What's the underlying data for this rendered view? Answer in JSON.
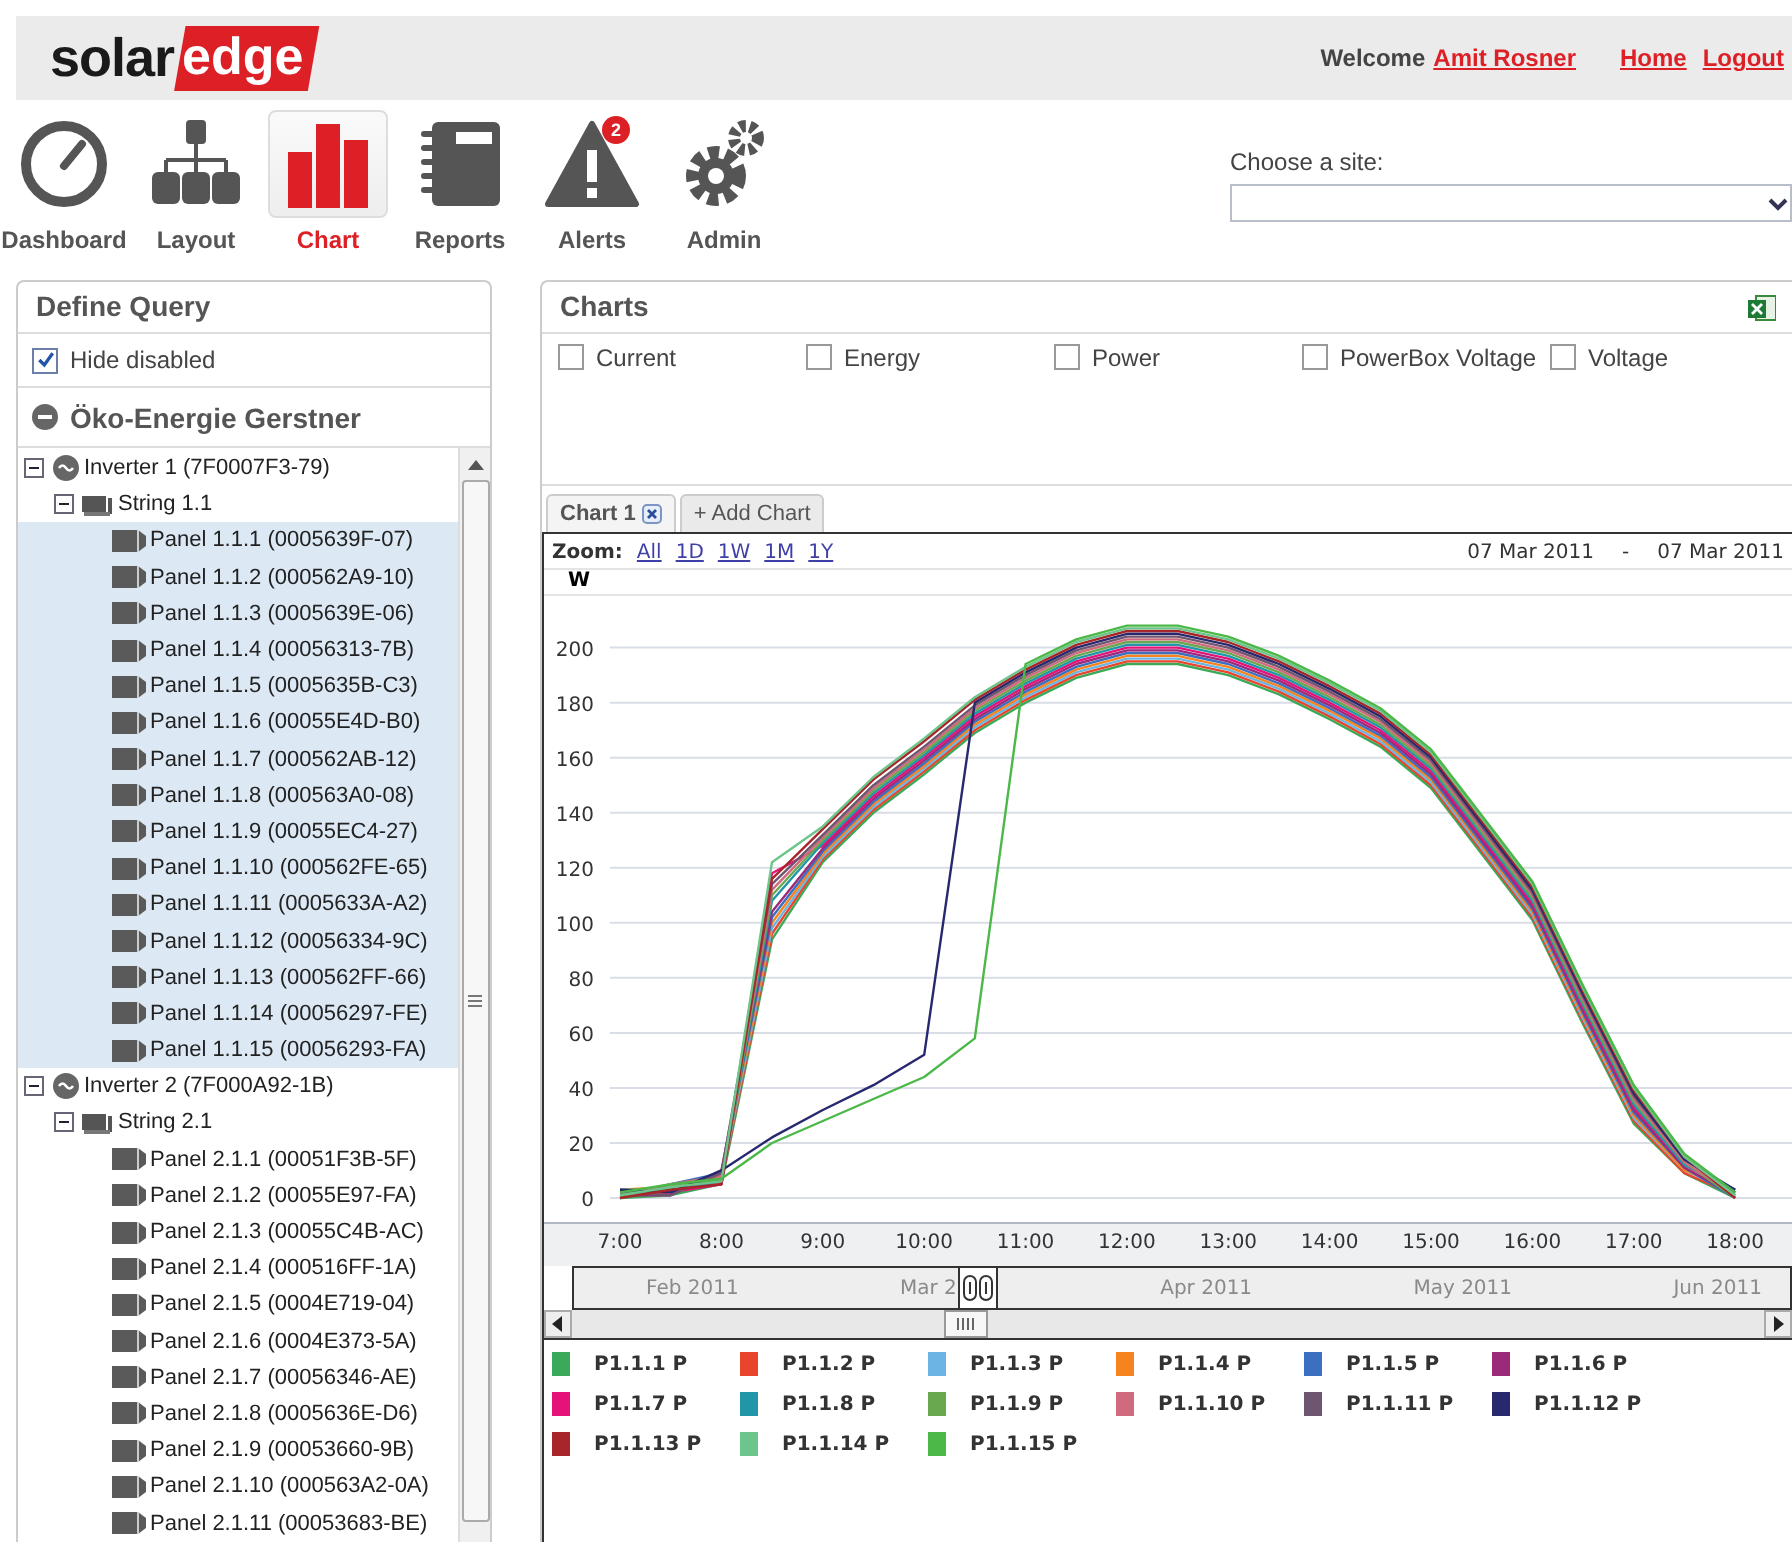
{
  "header": {
    "logo": {
      "text_1": "solar",
      "text_2": "edge"
    },
    "welcome": "Welcome",
    "user_link": "Amit Rosner",
    "links": [
      "Home",
      "Logout"
    ]
  },
  "nav": [
    {
      "label": "Dashboard",
      "kind": "gauge",
      "selected": false
    },
    {
      "label": "Layout",
      "kind": "hierarchy",
      "selected": false
    },
    {
      "label": "Chart",
      "kind": "bars",
      "selected": true
    },
    {
      "label": "Reports",
      "kind": "notebook",
      "selected": false
    },
    {
      "label": "Alerts",
      "kind": "warning",
      "selected": false,
      "badge": "2"
    },
    {
      "label": "Admin",
      "kind": "gears",
      "selected": false
    }
  ],
  "site_chooser": {
    "label": "Choose a site:"
  },
  "query_panel": {
    "title": "Define Query",
    "hide_disabled": {
      "label": "Hide disabled",
      "checked": true
    },
    "site_name": "Öko-Energie Gerstner",
    "tree": [
      {
        "label": "Inverter 1 (7F0007F3-79)",
        "kind": "inverter",
        "expanded": true,
        "selected": false,
        "children": [
          {
            "label": "String 1.1",
            "kind": "string",
            "expanded": true,
            "selected": false,
            "children": [
              {
                "label": "Panel 1.1.1 (0005639F-07)",
                "kind": "panel",
                "selected": true
              },
              {
                "label": "Panel 1.1.2 (000562A9-10)",
                "kind": "panel",
                "selected": true
              },
              {
                "label": "Panel 1.1.3 (0005639E-06)",
                "kind": "panel",
                "selected": true
              },
              {
                "label": "Panel 1.1.4 (00056313-7B)",
                "kind": "panel",
                "selected": true
              },
              {
                "label": "Panel 1.1.5 (0005635B-C3)",
                "kind": "panel",
                "selected": true
              },
              {
                "label": "Panel 1.1.6 (00055E4D-B0)",
                "kind": "panel",
                "selected": true
              },
              {
                "label": "Panel 1.1.7 (000562AB-12)",
                "kind": "panel",
                "selected": true
              },
              {
                "label": "Panel 1.1.8 (000563A0-08)",
                "kind": "panel",
                "selected": true
              },
              {
                "label": "Panel 1.1.9 (00055EC4-27)",
                "kind": "panel",
                "selected": true
              },
              {
                "label": "Panel 1.1.10 (000562FE-65)",
                "kind": "panel",
                "selected": true
              },
              {
                "label": "Panel 1.1.11 (0005633A-A2)",
                "kind": "panel",
                "selected": true
              },
              {
                "label": "Panel 1.1.12 (00056334-9C)",
                "kind": "panel",
                "selected": true
              },
              {
                "label": "Panel 1.1.13 (000562FF-66)",
                "kind": "panel",
                "selected": true
              },
              {
                "label": "Panel 1.1.14 (00056297-FE)",
                "kind": "panel",
                "selected": true
              },
              {
                "label": "Panel 1.1.15 (00056293-FA)",
                "kind": "panel",
                "selected": true
              }
            ]
          }
        ]
      },
      {
        "label": "Inverter 2 (7F000A92-1B)",
        "kind": "inverter",
        "expanded": true,
        "selected": false,
        "children": [
          {
            "label": "String 2.1",
            "kind": "string",
            "expanded": true,
            "selected": false,
            "children": [
              {
                "label": "Panel 2.1.1 (00051F3B-5F)",
                "kind": "panel",
                "selected": false
              },
              {
                "label": "Panel 2.1.2 (00055E97-FA)",
                "kind": "panel",
                "selected": false
              },
              {
                "label": "Panel 2.1.3 (00055C4B-AC)",
                "kind": "panel",
                "selected": false
              },
              {
                "label": "Panel 2.1.4 (000516FF-1A)",
                "kind": "panel",
                "selected": false
              },
              {
                "label": "Panel 2.1.5 (0004E719-04)",
                "kind": "panel",
                "selected": false
              },
              {
                "label": "Panel 2.1.6 (0004E373-5A)",
                "kind": "panel",
                "selected": false
              },
              {
                "label": "Panel 2.1.7 (00056346-AE)",
                "kind": "panel",
                "selected": false
              },
              {
                "label": "Panel 2.1.8 (0005636E-D6)",
                "kind": "panel",
                "selected": false
              },
              {
                "label": "Panel 2.1.9 (00053660-9B)",
                "kind": "panel",
                "selected": false
              },
              {
                "label": "Panel 2.1.10 (000563A2-0A)",
                "kind": "panel",
                "selected": false
              },
              {
                "label": "Panel 2.1.11 (00053683-BE)",
                "kind": "panel",
                "selected": false
              }
            ]
          }
        ]
      }
    ]
  },
  "charts_panel": {
    "title": "Charts",
    "measures": [
      {
        "label": "Current",
        "checked": false
      },
      {
        "label": "Energy",
        "checked": false
      },
      {
        "label": "Power",
        "checked": false
      },
      {
        "label": "PowerBox Voltage",
        "checked": false
      },
      {
        "label": "Voltage",
        "checked": false
      }
    ],
    "tabs": [
      {
        "label": "Chart 1",
        "selected": true,
        "closable": true
      },
      {
        "label": "+ Add Chart",
        "selected": false,
        "closable": false
      }
    ],
    "zoom": {
      "label": "Zoom:",
      "options": [
        "All",
        "1D",
        "1W",
        "1M",
        "1Y"
      ]
    },
    "date_range": {
      "from": "07 Mar 2011",
      "separator": "-",
      "to": "07 Mar 2011"
    },
    "chart_data": {
      "type": "line",
      "ylabel": "W",
      "grid": true,
      "x": [
        7,
        7.5,
        8,
        8.5,
        9,
        9.5,
        10,
        10.5,
        11,
        11.5,
        12,
        12.5,
        13,
        13.5,
        14,
        14.5,
        15,
        15.5,
        16,
        16.5,
        17,
        17.5,
        18
      ],
      "xlim": [
        6.25,
        18.6
      ],
      "ylim": [
        0,
        242
      ],
      "xticks": [
        {
          "value": 7,
          "label": "7:00"
        },
        {
          "value": 8,
          "label": "8:00"
        },
        {
          "value": 9,
          "label": "9:00"
        },
        {
          "value": 10,
          "label": "10:00"
        },
        {
          "value": 11,
          "label": "11:00"
        },
        {
          "value": 12,
          "label": "12:00"
        },
        {
          "value": 13,
          "label": "13:00"
        },
        {
          "value": 14,
          "label": "14:00"
        },
        {
          "value": 15,
          "label": "15:00"
        },
        {
          "value": 16,
          "label": "16:00"
        },
        {
          "value": 17,
          "label": "17:00"
        },
        {
          "value": 18,
          "label": "18:00"
        }
      ],
      "yticks": [
        0,
        20,
        40,
        60,
        80,
        100,
        120,
        140,
        160,
        180,
        200
      ],
      "series": [
        {
          "name": "P1.1.1 P",
          "color": "#3aaa5a",
          "values": [
            0,
            1,
            5,
            94,
            122,
            140,
            154,
            169,
            180,
            189,
            194,
            194,
            190,
            183,
            174,
            164,
            149,
            125,
            101,
            63,
            27,
            9,
            0
          ]
        },
        {
          "name": "P1.1.2 P",
          "color": "#e8452c",
          "values": [
            1,
            2,
            6,
            96,
            123,
            141,
            155,
            170,
            181,
            190,
            195,
            195,
            191,
            184,
            175,
            165,
            150,
            126,
            102,
            64,
            28,
            9,
            1
          ]
        },
        {
          "name": "P1.1.3 P",
          "color": "#6cb4e4",
          "values": [
            2,
            3,
            7,
            98,
            124,
            142,
            156,
            171,
            182,
            191,
            196,
            196,
            192,
            185,
            176,
            166,
            151,
            127,
            103,
            65,
            29,
            10,
            2
          ]
        },
        {
          "name": "P1.1.4 P",
          "color": "#f5841f",
          "values": [
            3,
            4,
            8,
            100,
            125,
            143,
            157,
            172,
            183,
            192,
            197,
            197,
            193,
            186,
            177,
            167,
            152,
            128,
            104,
            66,
            30,
            10,
            3
          ]
        },
        {
          "name": "P1.1.5 P",
          "color": "#3b6fbf",
          "values": [
            0,
            5,
            9,
            102,
            126,
            144,
            158,
            173,
            184,
            193,
            198,
            198,
            194,
            187,
            178,
            168,
            153,
            129,
            105,
            67,
            31,
            11,
            0
          ]
        },
        {
          "name": "P1.1.6 P",
          "color": "#9b2a7a",
          "values": [
            1,
            1,
            10,
            104,
            127,
            145,
            159,
            174,
            185,
            194,
            199,
            199,
            195,
            188,
            179,
            169,
            154,
            130,
            106,
            68,
            32,
            11,
            1
          ]
        },
        {
          "name": "P1.1.7 P",
          "color": "#e5127a",
          "values": [
            2,
            2,
            5,
            118,
            128,
            146,
            160,
            175,
            186,
            195,
            200,
            200,
            196,
            189,
            180,
            170,
            155,
            131,
            107,
            69,
            33,
            12,
            2
          ]
        },
        {
          "name": "P1.1.8 P",
          "color": "#2196a8",
          "values": [
            3,
            3,
            6,
            108,
            129,
            147,
            161,
            176,
            187,
            196,
            201,
            201,
            197,
            190,
            181,
            171,
            156,
            132,
            108,
            70,
            34,
            12,
            3
          ]
        },
        {
          "name": "P1.1.9 P",
          "color": "#6aa84f",
          "values": [
            0,
            4,
            7,
            110,
            130,
            148,
            162,
            177,
            188,
            197,
            202,
            202,
            198,
            191,
            182,
            172,
            157,
            133,
            109,
            71,
            35,
            13,
            0
          ]
        },
        {
          "name": "P1.1.10 P",
          "color": "#d06b7d",
          "values": [
            1,
            5,
            8,
            112,
            131,
            149,
            163,
            178,
            189,
            198,
            203,
            203,
            199,
            192,
            183,
            173,
            158,
            134,
            110,
            72,
            36,
            13,
            1
          ]
        },
        {
          "name": "P1.1.11 P",
          "color": "#6e5670",
          "values": [
            2,
            1,
            9,
            114,
            132,
            150,
            164,
            179,
            190,
            199,
            204,
            204,
            200,
            193,
            184,
            174,
            159,
            135,
            111,
            73,
            37,
            14,
            2
          ]
        },
        {
          "name": "P1.1.12 P",
          "color": "#27286e",
          "values": [
            3,
            2,
            10,
            22,
            32,
            41,
            52,
            180,
            191,
            200,
            205,
            205,
            201,
            194,
            185,
            175,
            160,
            136,
            112,
            74,
            38,
            14,
            3
          ]
        },
        {
          "name": "P1.1.13 P",
          "color": "#a8252a",
          "values": [
            0,
            3,
            5,
            116,
            134,
            152,
            166,
            181,
            192,
            201,
            206,
            206,
            202,
            195,
            186,
            176,
            161,
            137,
            113,
            75,
            39,
            15,
            0
          ]
        },
        {
          "name": "P1.1.14 P",
          "color": "#6cc58a",
          "values": [
            1,
            4,
            6,
            122,
            135,
            153,
            167,
            182,
            193,
            202,
            207,
            207,
            203,
            196,
            187,
            177,
            162,
            138,
            114,
            76,
            40,
            15,
            1
          ]
        },
        {
          "name": "P1.1.15 P",
          "color": "#4cb848",
          "values": [
            2,
            5,
            7,
            20,
            28,
            36,
            44,
            58,
            194,
            203,
            208,
            208,
            204,
            197,
            188,
            178,
            163,
            139,
            115,
            77,
            41,
            16,
            2
          ]
        }
      ]
    },
    "navigator": {
      "labels": [
        "Feb 2011",
        "Mar 2",
        "Apr 2011",
        "May 2011",
        "Jun 2011"
      ]
    }
  }
}
